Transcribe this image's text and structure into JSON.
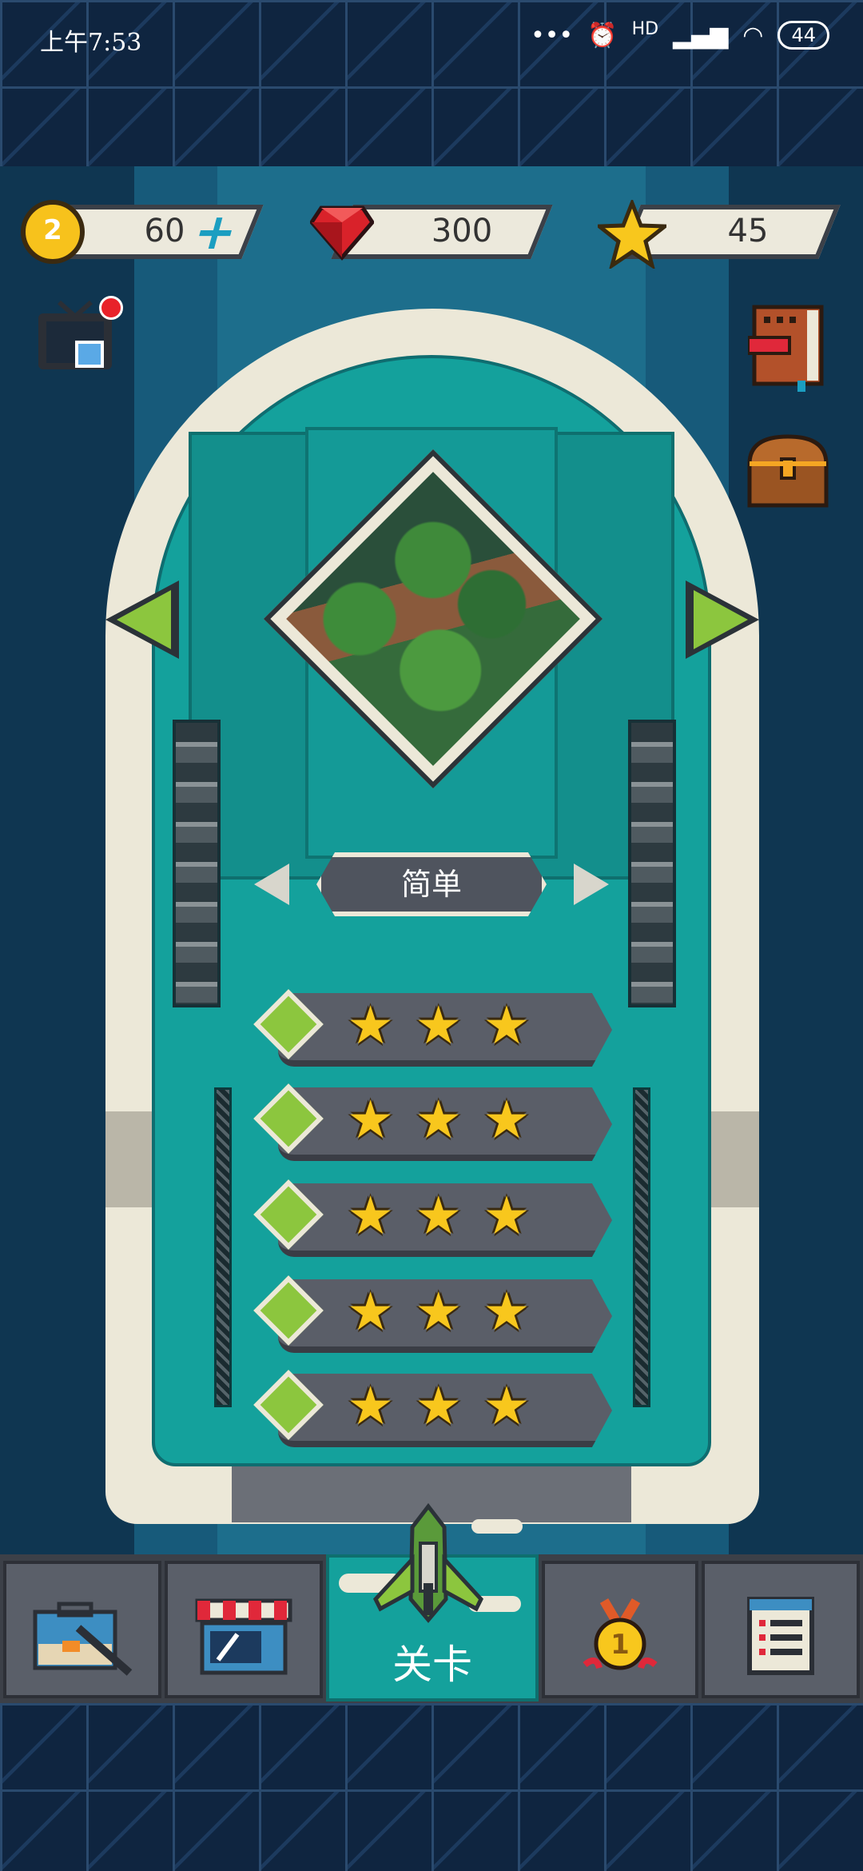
{
  "status_bar": {
    "time": "上午7:53",
    "signal_label": "HD",
    "battery": "44"
  },
  "currencies": {
    "coins": {
      "value": "60",
      "icon": "coin-icon"
    },
    "gems": {
      "value": "300",
      "icon": "gem-icon"
    },
    "stars": {
      "value": "45",
      "icon": "star-icon"
    }
  },
  "level_select": {
    "difficulty": "简单",
    "levels": [
      {
        "stars_earned": 3,
        "stars_max": 3
      },
      {
        "stars_earned": 3,
        "stars_max": 3
      },
      {
        "stars_earned": 3,
        "stars_max": 3
      },
      {
        "stars_earned": 3,
        "stars_max": 3
      },
      {
        "stars_earned": 3,
        "stars_max": 3
      }
    ]
  },
  "bottom_nav": {
    "items": [
      {
        "icon": "hangar-icon"
      },
      {
        "icon": "shop-icon"
      },
      {
        "icon": "jet-icon",
        "label": "关卡",
        "active": true
      },
      {
        "icon": "medal-icon"
      },
      {
        "icon": "clipboard-icon"
      }
    ]
  },
  "colors": {
    "accent_teal": "#14a19c",
    "star_yellow": "#f8c71d",
    "level_green": "#8cc63e",
    "badge_red": "#e8222a"
  }
}
